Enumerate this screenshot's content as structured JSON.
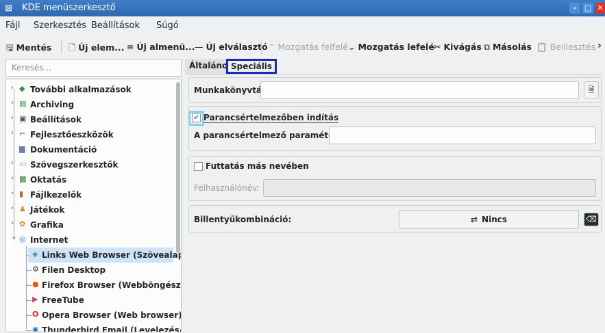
{
  "window": {
    "title": "KDE menüszerkesztő",
    "app_icon": "menu-editor-icon"
  },
  "menubar": [
    "Fájl",
    "Szerkesztés",
    "Beállítások",
    "Súgó"
  ],
  "toolbar": {
    "save": "Mentés",
    "new_item": "Új elem...",
    "new_submenu": "Új almenü...",
    "new_separator": "Új elválasztó",
    "move_up": "Mozgatás felfelé",
    "move_down": "Mozgatás lefelé",
    "cut": "Kivágás",
    "copy": "Másolás",
    "paste": "Beillesztés",
    "more": "›"
  },
  "search": {
    "placeholder": "Keresés..."
  },
  "tree": [
    {
      "label": "További alkalmazások",
      "icon": "folder-apps-icon",
      "expander": "›",
      "level": 0
    },
    {
      "label": "Archiving",
      "icon": "archive-icon",
      "expander": "›",
      "level": 0
    },
    {
      "label": "Beállítások",
      "icon": "settings-icon",
      "expander": "›",
      "level": 0
    },
    {
      "label": "Fejlesztőeszközök",
      "icon": "dev-tools-icon",
      "expander": "›",
      "level": 0
    },
    {
      "label": "Dokumentáció",
      "icon": "documentation-icon",
      "expander": "",
      "level": 0
    },
    {
      "label": "Szövegszerkesztők",
      "icon": "text-editor-icon",
      "expander": "›",
      "level": 0
    },
    {
      "label": "Oktatás",
      "icon": "education-icon",
      "expander": "›",
      "level": 0
    },
    {
      "label": "Fájlkezelők",
      "icon": "file-manager-icon",
      "expander": "›",
      "level": 0
    },
    {
      "label": "Játékok",
      "icon": "games-icon",
      "expander": "›",
      "level": 0
    },
    {
      "label": "Grafika",
      "icon": "graphics-icon",
      "expander": "›",
      "level": 0
    },
    {
      "label": "Internet",
      "icon": "internet-icon",
      "expander": "⌄",
      "level": 0
    },
    {
      "label": "Links Web Browser (Szövealapu ...",
      "icon": "links-browser-icon",
      "expander": "",
      "level": 1,
      "selected": true
    },
    {
      "label": "Filen Desktop",
      "icon": "filen-icon",
      "expander": "",
      "level": 1
    },
    {
      "label": "Firefox Browser (Webböngésző)",
      "icon": "firefox-icon",
      "expander": "",
      "level": 1
    },
    {
      "label": "FreeTube",
      "icon": "freetube-icon",
      "expander": "",
      "level": 1
    },
    {
      "label": "Opera Browser (Web browser)",
      "icon": "opera-icon",
      "expander": "",
      "level": 1
    },
    {
      "label": "Thunderbird Email (Levelezés/hí...",
      "icon": "thunderbird-icon",
      "expander": "",
      "level": 1
    }
  ],
  "tabs": {
    "general": "Általános",
    "special": "Speciális"
  },
  "form": {
    "workdir_label": "Munkakönyvtár:",
    "workdir_value": "",
    "terminal_checkbox_label": "Parancsértelmezőben indítás",
    "terminal_checked": true,
    "terminal_params_label": "A parancsértelmező paraméterei:",
    "terminal_params_value": "",
    "other_user_label": "Futtatás más nevében",
    "other_user_checked": false,
    "username_label": "Felhasználónév:",
    "username_value": "",
    "shortcut_label": "Billentyűkombináció:",
    "shortcut_value": "Nincs"
  },
  "colors": {
    "accent": "#2a7fd4",
    "selection": "#cde3f7",
    "tab_highlight": "#1a2ab5",
    "checkbox_highlight": "#79d8f0"
  }
}
